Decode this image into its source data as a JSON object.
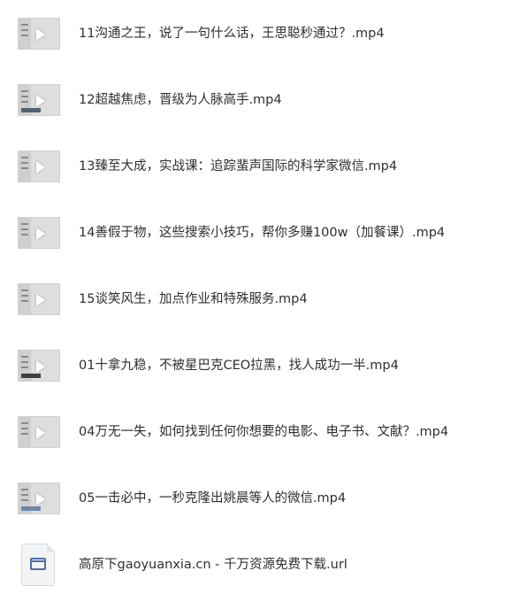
{
  "files": [
    {
      "name": "11沟通之王，说了一句什么话，王思聪秒通过？.mp4",
      "icon": "video-thumbnail-icon"
    },
    {
      "name": "12超越焦虑，晋级为人脉高手.mp4",
      "icon": "video-thumbnail-icon"
    },
    {
      "name": "13臻至大成，实战课：追踪蜚声国际的科学家微信.mp4",
      "icon": "video-thumbnail-icon"
    },
    {
      "name": "14善假于物，这些搜索小技巧，帮你多赚100w（加餐课）.mp4",
      "icon": "video-thumbnail-icon"
    },
    {
      "name": "15谈笑风生，加点作业和特殊服务.mp4",
      "icon": "video-thumbnail-icon"
    },
    {
      "name": "01十拿九稳，不被星巴克CEO拉黑，找人成功一半.mp4",
      "icon": "video-thumbnail-icon"
    },
    {
      "name": "04万无一失，如何找到任何你想要的电影、电子书、文献？.mp4",
      "icon": "video-thumbnail-icon"
    },
    {
      "name": "05一击必中，一秒克隆出姚晨等人的微信.mp4",
      "icon": "video-thumbnail-icon"
    },
    {
      "name": "高原下gaoyuanxia.cn - 千万资源免费下载.url",
      "icon": "url-file-icon"
    }
  ],
  "colors": {
    "text": "#2f2f2f",
    "thumb_bg": "#dedede",
    "url_icon_accent": "#4a6fa5"
  }
}
